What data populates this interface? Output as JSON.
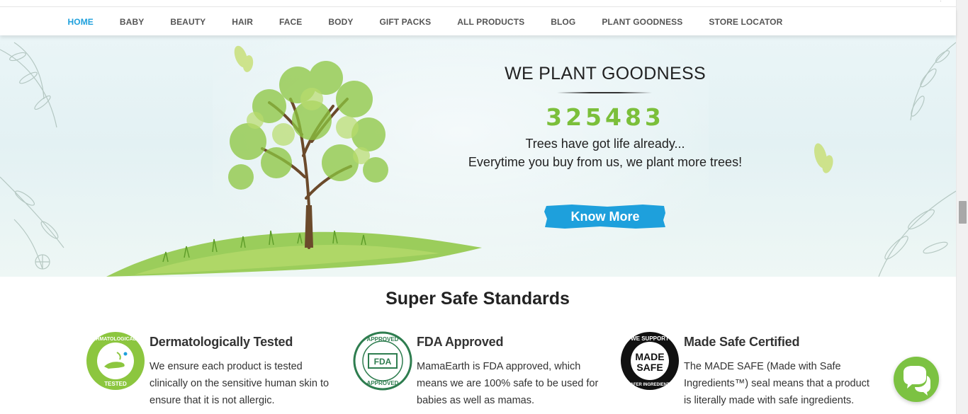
{
  "nav": {
    "items": [
      {
        "label": "HOME",
        "active": true
      },
      {
        "label": "BABY"
      },
      {
        "label": "BEAUTY"
      },
      {
        "label": "HAIR"
      },
      {
        "label": "FACE"
      },
      {
        "label": "BODY"
      },
      {
        "label": "GIFT PACKS"
      },
      {
        "label": "ALL PRODUCTS"
      },
      {
        "label": "BLOG"
      },
      {
        "label": "PLANT GOODNESS"
      },
      {
        "label": "STORE LOCATOR"
      }
    ]
  },
  "banner": {
    "title": "WE PLANT GOODNESS",
    "count": "325483",
    "line1": "Trees have got life already...",
    "line2": "Everytime you buy from us, we plant more trees!",
    "button_label": "Know More"
  },
  "standards": {
    "title": "Super Safe Standards",
    "items": [
      {
        "title": "Dermatologically Tested",
        "description": "We ensure each product is tested clinically on the sensitive human skin to ensure that it is not allergic.",
        "badge_top": "DERMATOLOGICALLY",
        "badge_bottom": "TESTED",
        "icon": "dermatologically-tested-badge"
      },
      {
        "title": "FDA Approved",
        "description": "MamaEarth is FDA approved, which means we are 100% safe to be used for babies as well as mamas.",
        "badge_top": "APPROVED",
        "badge_middle": "FDA",
        "badge_bottom": "APPROVED",
        "icon": "fda-approved-badge"
      },
      {
        "title": "Made Safe Certified",
        "description": "The MADE SAFE (Made with Safe Ingredients™) seal means that a product is literally made with safe ingredients.",
        "badge_top": "WE SUPPORT",
        "badge_middle1": "MADE",
        "badge_middle2": "SAFE",
        "badge_bottom": "SAFER INGREDIENTS",
        "icon": "made-safe-badge"
      }
    ]
  },
  "colors": {
    "accent_blue": "#1ea0dc",
    "counter_green": "#7bbf3a",
    "chat_green": "#7cc242"
  },
  "chat": {
    "icon": "chat-bubbles-icon"
  }
}
